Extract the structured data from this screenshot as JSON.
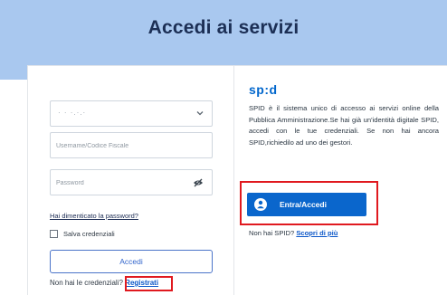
{
  "header": {
    "title": "Accedi ai servizi"
  },
  "login": {
    "select_value": "· · ·.·.·",
    "username_placeholder": "Username/Codice Fiscale",
    "password_placeholder": "Password",
    "forgot_password": "Hai dimenticato la password?",
    "remember_label": "Salva credenziali",
    "remember_checked": false,
    "submit_label": "Accedi",
    "signup_prefix": "Non hai le credenziali?",
    "signup_link": "Registrati"
  },
  "spid": {
    "logo": "sp:d",
    "description": "SPID è il sistema unico di accesso ai servizi online della Pubblica Amministrazione.Se hai già un'identità digitale SPID, accedi con le tue credenziali. Se non hai ancora SPID,richiedilo ad uno dei gestori.",
    "button_label": "Entra/Accedi",
    "no_spid_prefix": "Non hai SPID?",
    "discover_link": "Scopri di più"
  },
  "colors": {
    "header_band": "#a9c8ef",
    "title_text": "#1c2f55",
    "spid_blue": "#0a66cc",
    "highlight_red": "#e0191f"
  },
  "icons": {
    "select": "chevron-down-icon",
    "password": "eye-slash-icon",
    "spid_button": "user-icon"
  }
}
